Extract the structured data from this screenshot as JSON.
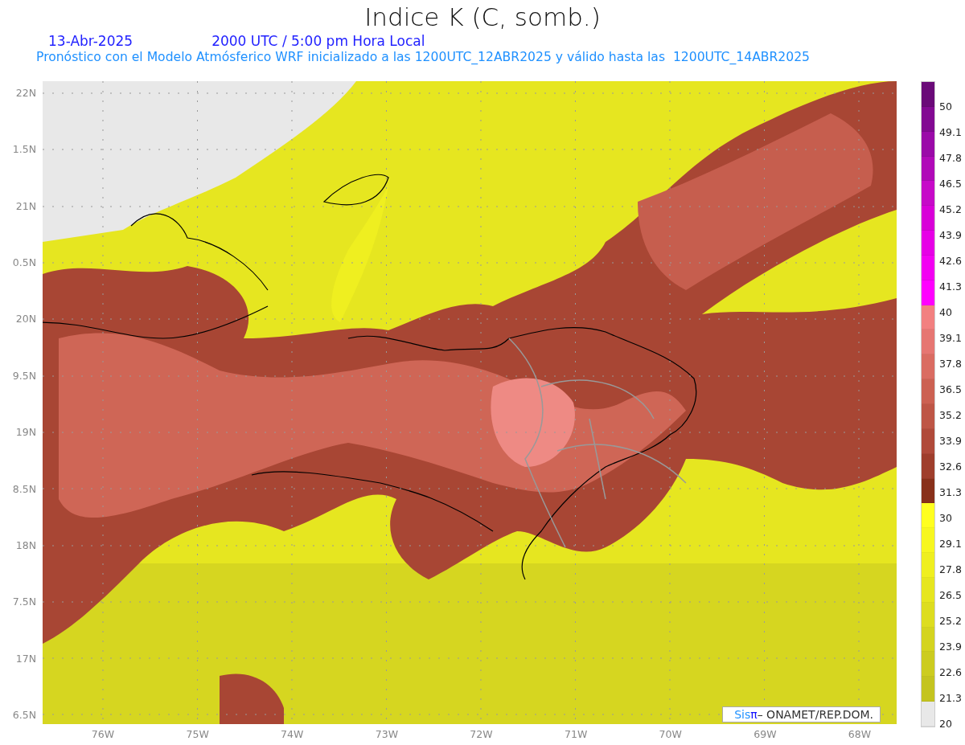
{
  "title": "Indice K (C, somb.)",
  "date": "13-Abr-2025",
  "time": "2000 UTC / 5:00 pm Hora Local",
  "subtitle": "Pronóstico con el Modelo Atmósferico WRF inicializado a las 1200UTC_12ABR2025 y válido hasta las  1200UTC_14ABR2025",
  "y_ticks": [
    "22N",
    "1.5N",
    "21N",
    "0.5N",
    "20N",
    "9.5N",
    "19N",
    "8.5N",
    "18N",
    "7.5N",
    "17N",
    "6.5N"
  ],
  "x_ticks": [
    "76W",
    "75W",
    "74W",
    "73W",
    "72W",
    "71W",
    "70W",
    "69W",
    "68W"
  ],
  "credit": {
    "logo_first": "Sis",
    "logo_second": "π",
    "text": "– ONAMET/REP.DOM."
  },
  "colorbar": {
    "segments": [
      {
        "color": "#6a0a78"
      },
      {
        "color": "#820a92"
      },
      {
        "color": "#9a0aa8"
      },
      {
        "color": "#b00ab8"
      },
      {
        "color": "#c60ac8"
      },
      {
        "color": "#d800d8"
      },
      {
        "color": "#e600e6"
      },
      {
        "color": "#f200f2"
      },
      {
        "color": "#ff00ff"
      },
      {
        "color": "#f28080"
      },
      {
        "color": "#e67672"
      },
      {
        "color": "#da6c62"
      },
      {
        "color": "#cc6152"
      },
      {
        "color": "#be5646"
      },
      {
        "color": "#b04a3a"
      },
      {
        "color": "#9f3e2c"
      },
      {
        "color": "#88301a"
      },
      {
        "color": "#ffff20"
      },
      {
        "color": "#f7f720"
      },
      {
        "color": "#efef20"
      },
      {
        "color": "#e6e620"
      },
      {
        "color": "#dddd20"
      },
      {
        "color": "#d4d420"
      },
      {
        "color": "#cccc20"
      },
      {
        "color": "#c4c420"
      },
      {
        "color": "#e8e8e8"
      }
    ],
    "labels": [
      "50",
      "49.1",
      "47.8",
      "46.5",
      "45.2",
      "43.9",
      "42.6",
      "41.3",
      "40",
      "39.1",
      "37.8",
      "36.5",
      "35.2",
      "33.9",
      "32.6",
      "31.3",
      "30",
      "29.1",
      "27.8",
      "26.5",
      "25.2",
      "23.9",
      "22.6",
      "21.3",
      "20"
    ]
  }
}
